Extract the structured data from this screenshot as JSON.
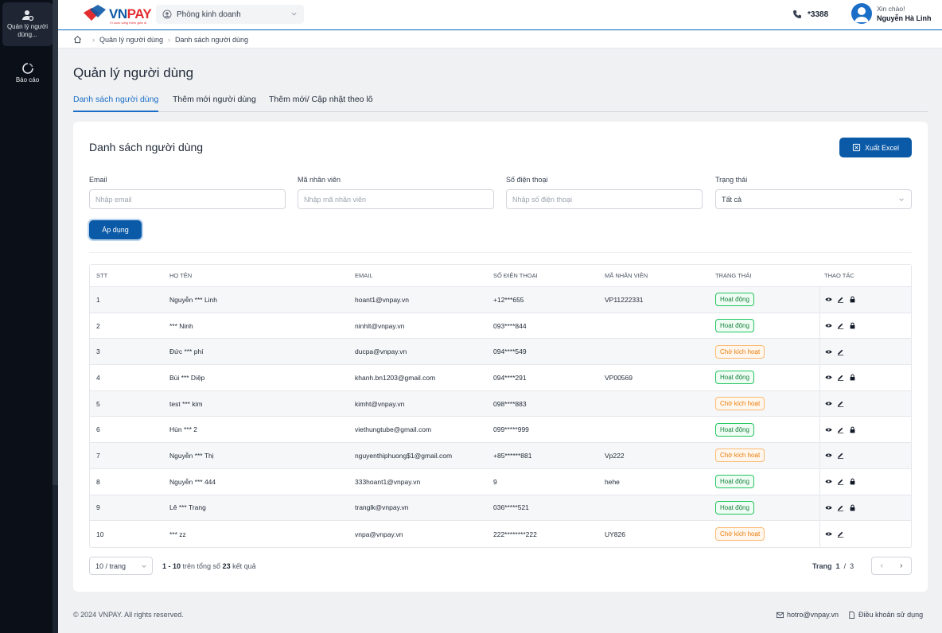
{
  "sidebar": {
    "items": [
      {
        "label": "Quản lý người dùng...",
        "icon": "user-gear-icon",
        "active": true
      },
      {
        "label": "Báo cáo",
        "icon": "report-icon",
        "active": false
      }
    ]
  },
  "header": {
    "logo_text_blue": "VN",
    "logo_text_red": "PAY",
    "logo_tagline": "Vì cuộc sống thêm giản dị",
    "department": "Phòng kinh doanh",
    "hotline": "*3388",
    "greeting": "Xin chào!",
    "user_name": "Nguyễn Hà Linh"
  },
  "breadcrumb": [
    "Quản lý người dùng",
    "Danh sách người dùng"
  ],
  "page_title": "Quản lý người dùng",
  "tabs": [
    {
      "label": "Danh sách người dùng",
      "active": true
    },
    {
      "label": "Thêm mới người dùng",
      "active": false
    },
    {
      "label": "Thêm mới/ Cập nhật theo lô",
      "active": false
    }
  ],
  "card": {
    "title": "Danh sách người dùng",
    "export_label": "Xuất Excel",
    "apply_label": "Áp dụng"
  },
  "filters": {
    "email": {
      "label": "Email",
      "placeholder": "Nhập email",
      "value": ""
    },
    "employee_code": {
      "label": "Mã nhân viên",
      "placeholder": "Nhập mã nhân viên",
      "value": ""
    },
    "phone": {
      "label": "Số điện thoại",
      "placeholder": "Nhập số điện thoại",
      "value": ""
    },
    "status": {
      "label": "Trạng thái",
      "value": "Tất cả"
    }
  },
  "table": {
    "columns": [
      "STT",
      "Họ tên",
      "Email",
      "Số điện thoại",
      "Mã nhân viên",
      "Trạng thái",
      "Thao tác"
    ],
    "rows": [
      {
        "stt": "1",
        "name": "Nguyễn *** Linh",
        "email": "hoant1@vnpay.vn",
        "phone": "+12***655",
        "code": "VP11222331",
        "status": "Hoạt động",
        "status_type": "ok",
        "lock": true
      },
      {
        "stt": "2",
        "name": "*** Ninh",
        "email": "ninhlt@vnpay.vn",
        "phone": "093****844",
        "code": "",
        "status": "Hoạt động",
        "status_type": "ok",
        "lock": true
      },
      {
        "stt": "3",
        "name": "Đức *** phí",
        "email": "ducpa@vnpay.vn",
        "phone": "094****549",
        "code": "",
        "status": "Chờ kích hoạt",
        "status_type": "wait",
        "lock": false
      },
      {
        "stt": "4",
        "name": "Bùi *** Diệp",
        "email": "khanh.bn1203@gmail.com",
        "phone": "094****291",
        "code": "VP00569",
        "status": "Hoạt động",
        "status_type": "ok",
        "lock": true
      },
      {
        "stt": "5",
        "name": "test *** kim",
        "email": "kimht@vnpay.vn",
        "phone": "098****883",
        "code": "",
        "status": "Chờ kích hoạt",
        "status_type": "wait",
        "lock": false
      },
      {
        "stt": "6",
        "name": "Hùn *** 2",
        "email": "viethungtube@gmail.com",
        "phone": "099*****999",
        "code": "",
        "status": "Hoạt động",
        "status_type": "ok",
        "lock": true
      },
      {
        "stt": "7",
        "name": "Nguyễn *** Thị",
        "email": "nguyenthiphuong$1@gmail.com",
        "phone": "+85******881",
        "code": "Vp222",
        "status": "Chờ kích hoạt",
        "status_type": "wait",
        "lock": false
      },
      {
        "stt": "8",
        "name": "Nguyễn *** 444",
        "email": "333hoant1@vnpay.vn",
        "phone": "9",
        "code": "hehe",
        "status": "Hoạt động",
        "status_type": "ok",
        "lock": true
      },
      {
        "stt": "9",
        "name": "Lê *** Trang",
        "email": "tranglk@vnpay.vn",
        "phone": "036*****521",
        "code": "",
        "status": "Hoạt động",
        "status_type": "ok",
        "lock": true
      },
      {
        "stt": "10",
        "name": "*** zz",
        "email": "vnpa@vnpay.vn",
        "phone": "222********222",
        "code": "UY826",
        "status": "Chờ kích hoạt",
        "status_type": "wait",
        "lock": false
      }
    ]
  },
  "pagination": {
    "page_size": "10 / trang",
    "range": "1 - 10",
    "total_prefix": "trên tổng số",
    "total": "23",
    "total_suffix": "kết quả",
    "page_label": "Trang",
    "current_page": "1",
    "page_separator": "/",
    "total_pages": "3",
    "prev": "‹",
    "next": "›"
  },
  "footer": {
    "copyright": "© 2024 VNPAY. All rights reserved.",
    "email": "hotro@vnpay.vn",
    "terms": "Điều khoản sử dụng"
  },
  "colors": {
    "primary": "#0b5aa8",
    "sidebar_bg": "#0b0f17",
    "active_green": "#22c55e",
    "pending_orange": "#fdba74"
  }
}
